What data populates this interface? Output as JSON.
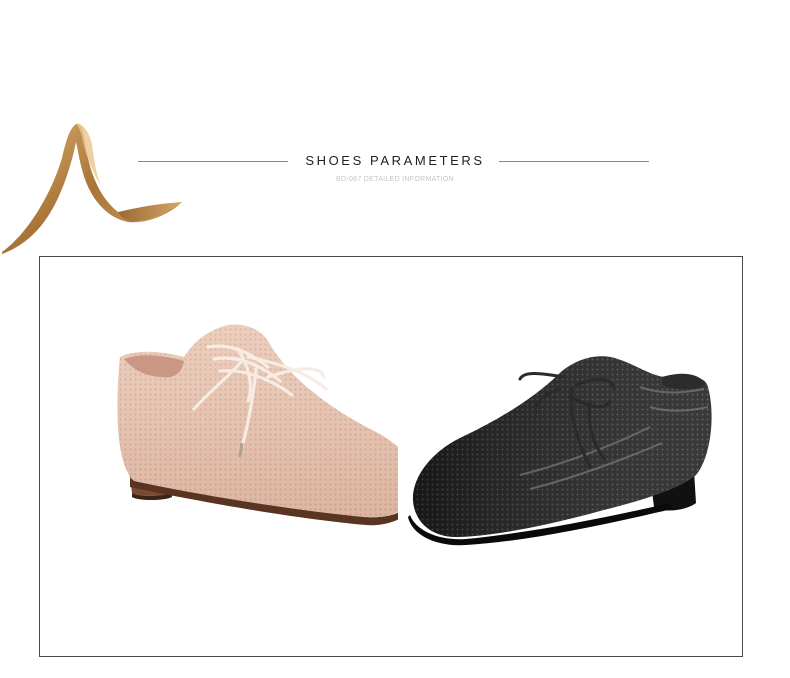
{
  "header": {
    "title": "SHOES PARAMETERS",
    "subtitle": "BD-067 DETAILED INFORMATION"
  },
  "decor": {
    "ribbon": "gold-ribbon-ornament",
    "ribbon_color": "#b8864a"
  },
  "product_photo": {
    "left_shoe_color": "#e8c2ae",
    "right_shoe_color": "#1c1c1c"
  }
}
